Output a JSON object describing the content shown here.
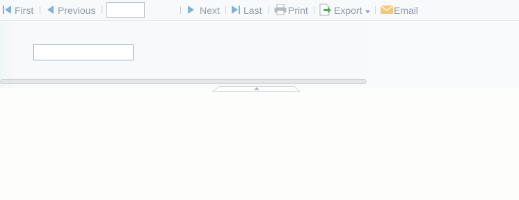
{
  "toolbar": {
    "first_label": "First",
    "previous_label": "Previous",
    "page_number_value": "",
    "next_label": "Next",
    "last_label": "Last",
    "print_label": "Print",
    "export_label": "Export",
    "email_label": "Email"
  },
  "form": {
    "field_value": ""
  },
  "colors": {
    "nav_arrow": "#7fb2d9",
    "export_icon": "#4caf50",
    "email_icon": "#f3c87a"
  },
  "icons": {
    "first": "first-page-icon",
    "previous": "previous-page-icon",
    "next": "next-page-icon",
    "last": "last-page-icon",
    "print": "printer-icon",
    "export": "export-icon",
    "email": "email-icon",
    "dropdown": "chevron-down-icon",
    "collapse": "collapse-arrow-icon"
  }
}
